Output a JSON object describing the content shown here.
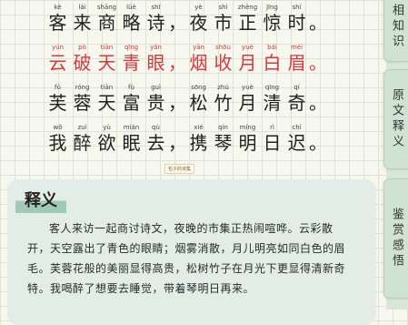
{
  "poem": {
    "lines": [
      {
        "red": false,
        "chars": [
          {
            "h": "客",
            "p": "kè"
          },
          {
            "h": "来",
            "p": "lái"
          },
          {
            "h": "商",
            "p": "shāng"
          },
          {
            "h": "略",
            "p": "lüè"
          },
          {
            "h": "诗",
            "p": "shī"
          },
          {
            "h": "，",
            "p": ""
          },
          {
            "h": "夜",
            "p": "yè"
          },
          {
            "h": "市",
            "p": "shì"
          },
          {
            "h": "正",
            "p": "zhèng"
          },
          {
            "h": "惊",
            "p": "jīng"
          },
          {
            "h": "时",
            "p": "shí"
          },
          {
            "h": "。",
            "p": ""
          }
        ]
      },
      {
        "red": true,
        "chars": [
          {
            "h": "云",
            "p": "yún"
          },
          {
            "h": "破",
            "p": "pò"
          },
          {
            "h": "天",
            "p": "tiān"
          },
          {
            "h": "青",
            "p": "qīng"
          },
          {
            "h": "眼",
            "p": "yǎn"
          },
          {
            "h": "，",
            "p": ""
          },
          {
            "h": "烟",
            "p": "yān"
          },
          {
            "h": "收",
            "p": "shōu"
          },
          {
            "h": "月",
            "p": "yuè"
          },
          {
            "h": "白",
            "p": "bái"
          },
          {
            "h": "眉",
            "p": "méi"
          },
          {
            "h": "。",
            "p": ""
          }
        ]
      },
      {
        "red": false,
        "chars": [
          {
            "h": "芙",
            "p": "fú"
          },
          {
            "h": "蓉",
            "p": "róng"
          },
          {
            "h": "天",
            "p": "tiān"
          },
          {
            "h": "富",
            "p": "fù"
          },
          {
            "h": "贵",
            "p": "guì"
          },
          {
            "h": "，",
            "p": ""
          },
          {
            "h": "松",
            "p": "sōng"
          },
          {
            "h": "竹",
            "p": "zhú"
          },
          {
            "h": "月",
            "p": "yuè"
          },
          {
            "h": "清",
            "p": "qīng"
          },
          {
            "h": "奇",
            "p": "qí"
          },
          {
            "h": "。",
            "p": ""
          }
        ]
      },
      {
        "red": false,
        "chars": [
          {
            "h": "我",
            "p": "wǒ"
          },
          {
            "h": "醉",
            "p": "zuì"
          },
          {
            "h": "欲",
            "p": "yù"
          },
          {
            "h": "眠",
            "p": "mián"
          },
          {
            "h": "去",
            "p": "qù"
          },
          {
            "h": "，",
            "p": ""
          },
          {
            "h": "携",
            "p": "xié"
          },
          {
            "h": "琴",
            "p": "qín"
          },
          {
            "h": "明",
            "p": "míng"
          },
          {
            "h": "日",
            "p": "rì"
          },
          {
            "h": "迟",
            "p": "chí"
          },
          {
            "h": "。",
            "p": ""
          }
        ]
      }
    ]
  },
  "stamp": "包子的诗集",
  "explanation": {
    "title": "释义",
    "body": "客人来访一起商讨诗文，夜晚的市集正热闹喧哗。云彩散开，天空露出了青色的眼睛；烟雾消散，月儿明亮如同白色的眉毛。芙蓉花般的美丽显得高贵，松树竹子在月光下更显得清新奇特。我喝醉了想要去睡觉，带着琴明日再来。"
  },
  "tabs": {
    "tab1": "相知识",
    "tab2": "原文释义",
    "tab3": "鉴赏感悟"
  }
}
